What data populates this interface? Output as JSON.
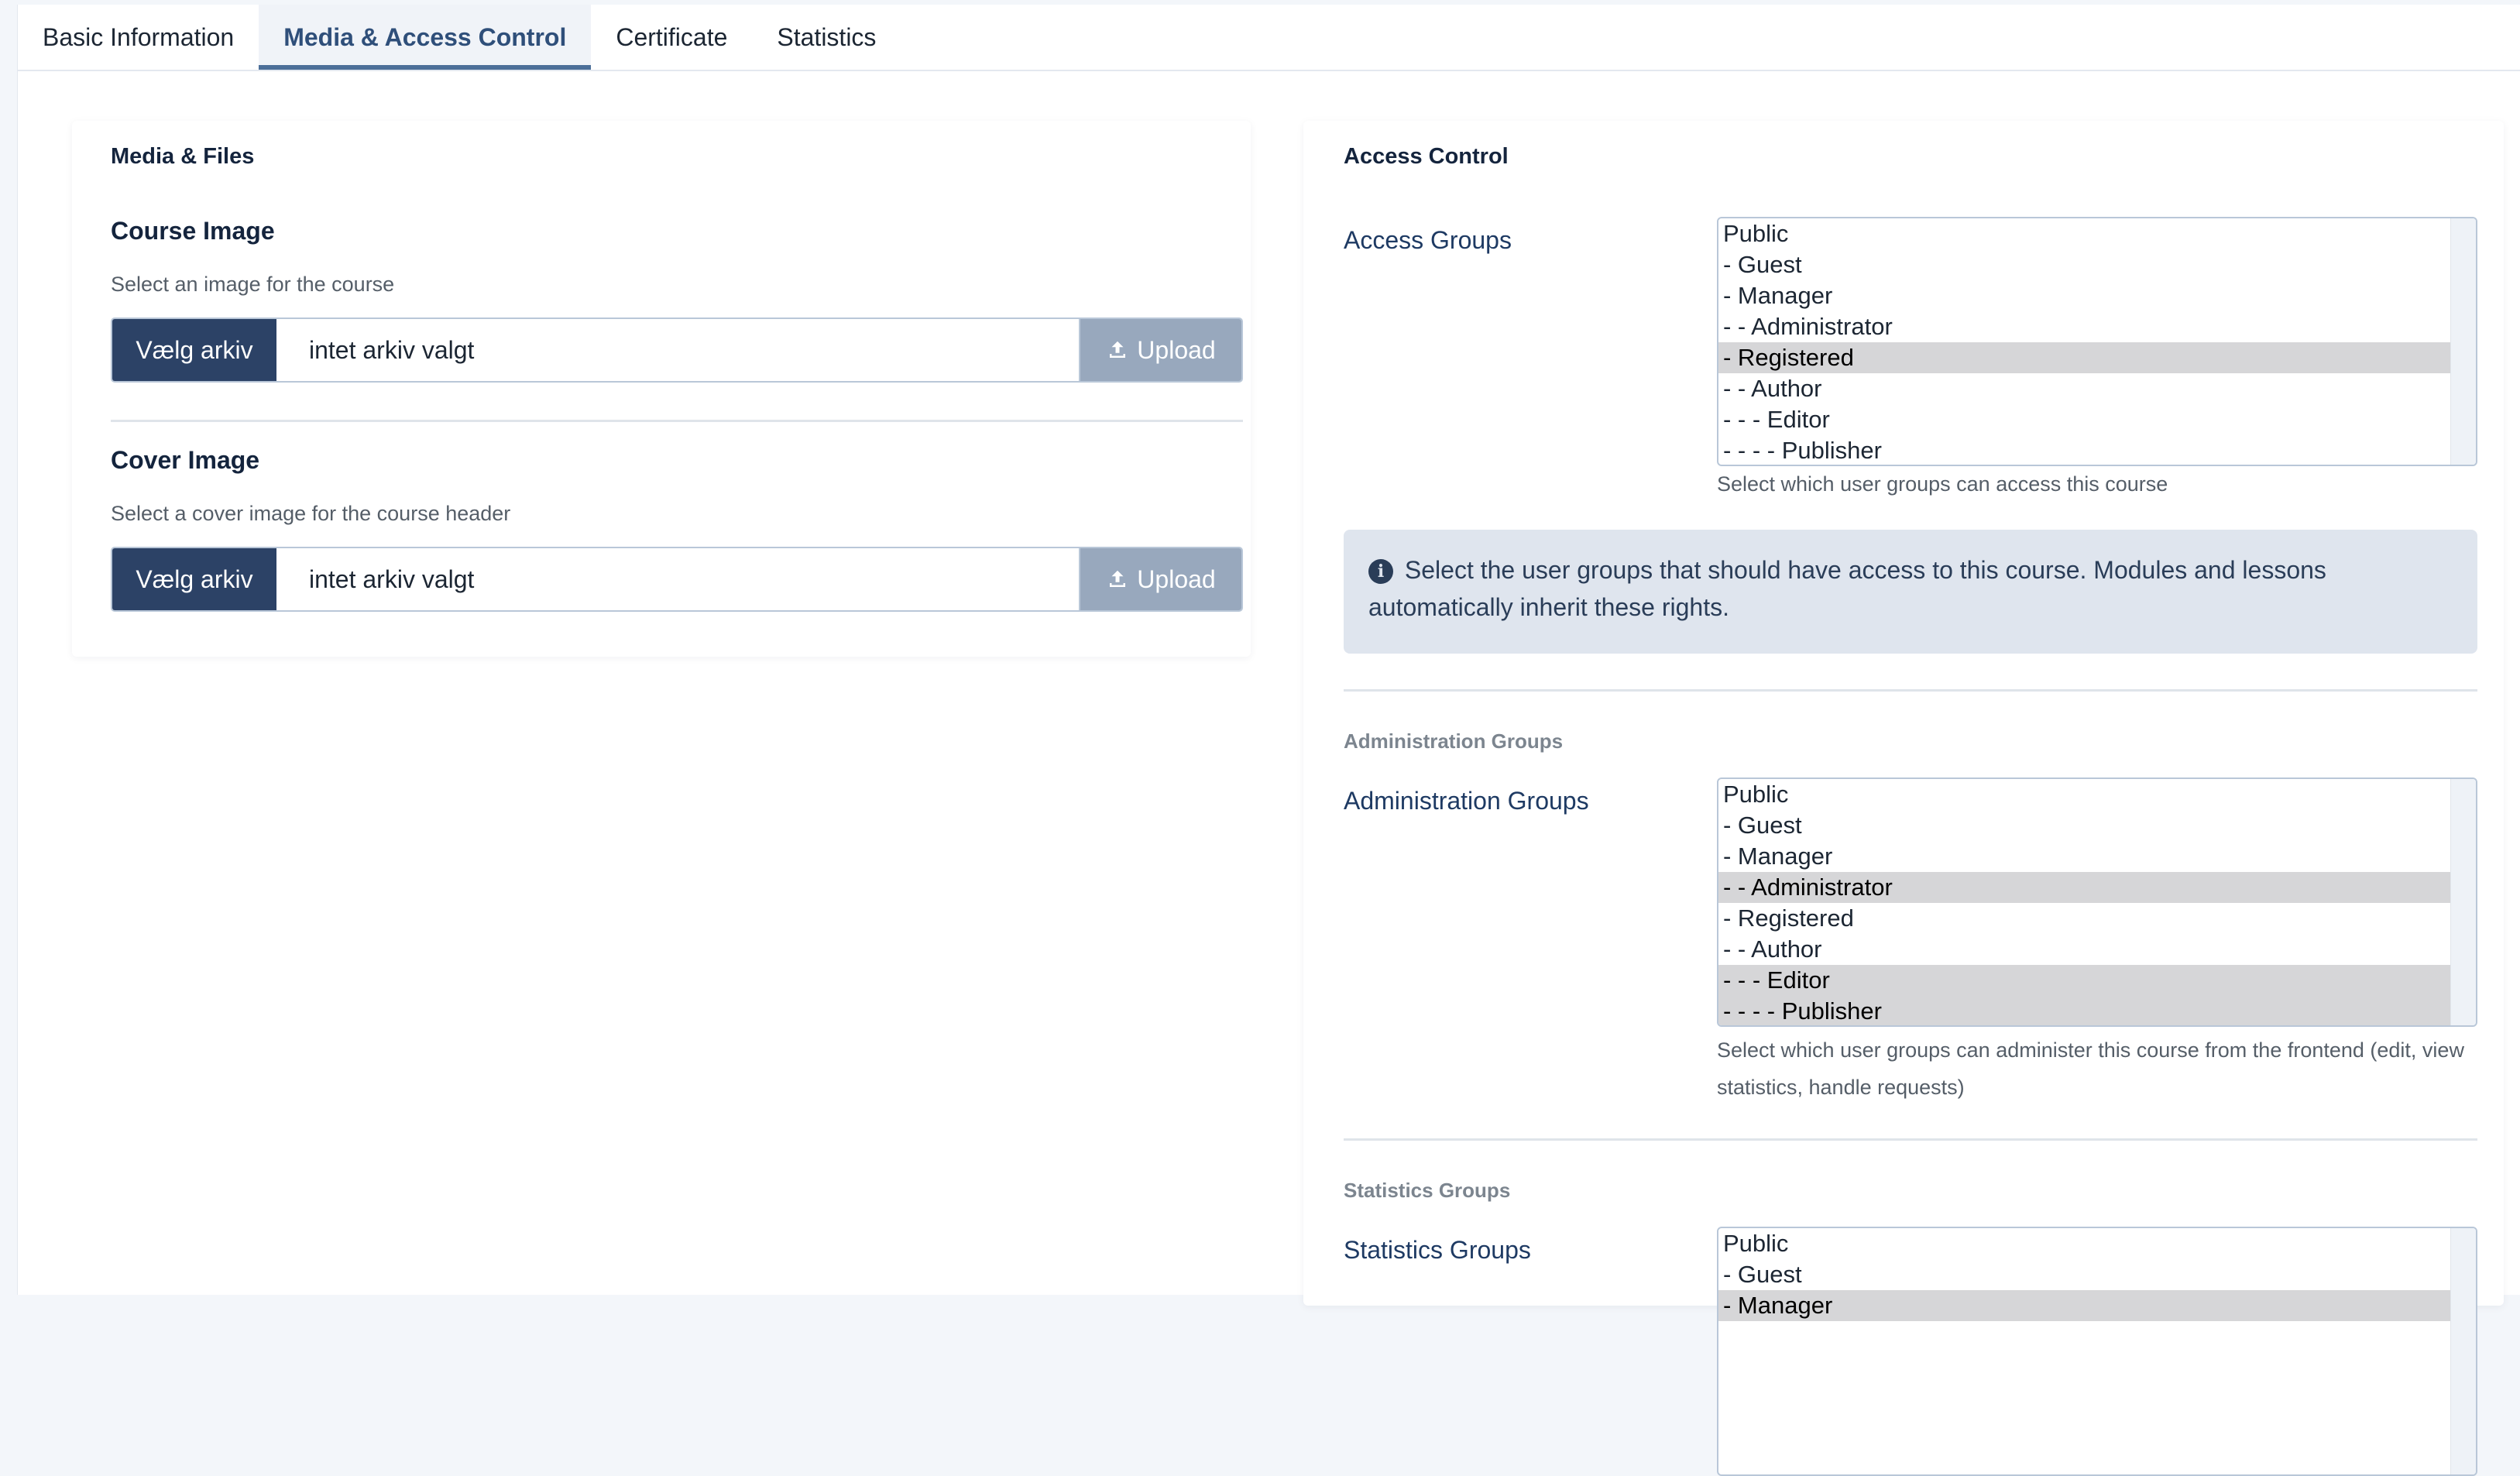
{
  "tabs": [
    {
      "label": "Basic Information"
    },
    {
      "label": "Media & Access Control"
    },
    {
      "label": "Certificate"
    },
    {
      "label": "Statistics"
    }
  ],
  "media": {
    "title": "Media & Files",
    "course_image": {
      "title": "Course Image",
      "hint": "Select an image for the course",
      "choose_label": "Vælg arkiv",
      "file_name": "intet arkiv valgt",
      "upload_label": "Upload"
    },
    "cover_image": {
      "title": "Cover Image",
      "hint": "Select a cover image for the course header",
      "choose_label": "Vælg arkiv",
      "file_name": "intet arkiv valgt",
      "upload_label": "Upload"
    }
  },
  "access": {
    "title": "Access Control",
    "access_groups": {
      "label": "Access Groups",
      "hint": "Select which user groups can access this course",
      "options": [
        {
          "label": "Public",
          "selected": false
        },
        {
          "label": "- Guest",
          "selected": false
        },
        {
          "label": "- Manager",
          "selected": false
        },
        {
          "label": "- - Administrator",
          "selected": false
        },
        {
          "label": "- Registered",
          "selected": true
        },
        {
          "label": "- - Author",
          "selected": false
        },
        {
          "label": "- - - Editor",
          "selected": false
        },
        {
          "label": "- - - - Publisher",
          "selected": false
        }
      ]
    },
    "alert_text": "Select the user groups that should have access to this course. Modules and lessons automatically inherit these rights.",
    "admin_section_title": "Administration Groups",
    "admin_groups": {
      "label": "Administration Groups",
      "hint": "Select which user groups can administer this course from the frontend (edit, view statistics, handle requests)",
      "options": [
        {
          "label": "Public",
          "selected": false
        },
        {
          "label": "- Guest",
          "selected": false
        },
        {
          "label": "- Manager",
          "selected": false
        },
        {
          "label": "- - Administrator",
          "selected": true
        },
        {
          "label": "- Registered",
          "selected": false
        },
        {
          "label": "- - Author",
          "selected": false
        },
        {
          "label": "- - - Editor",
          "selected": true
        },
        {
          "label": "- - - - Publisher",
          "selected": true
        }
      ]
    },
    "stats_section_title": "Statistics Groups",
    "stats_groups": {
      "label": "Statistics Groups",
      "options": [
        {
          "label": "Public",
          "selected": false
        },
        {
          "label": "- Guest",
          "selected": false
        },
        {
          "label": "- Manager",
          "selected": true
        }
      ]
    }
  }
}
